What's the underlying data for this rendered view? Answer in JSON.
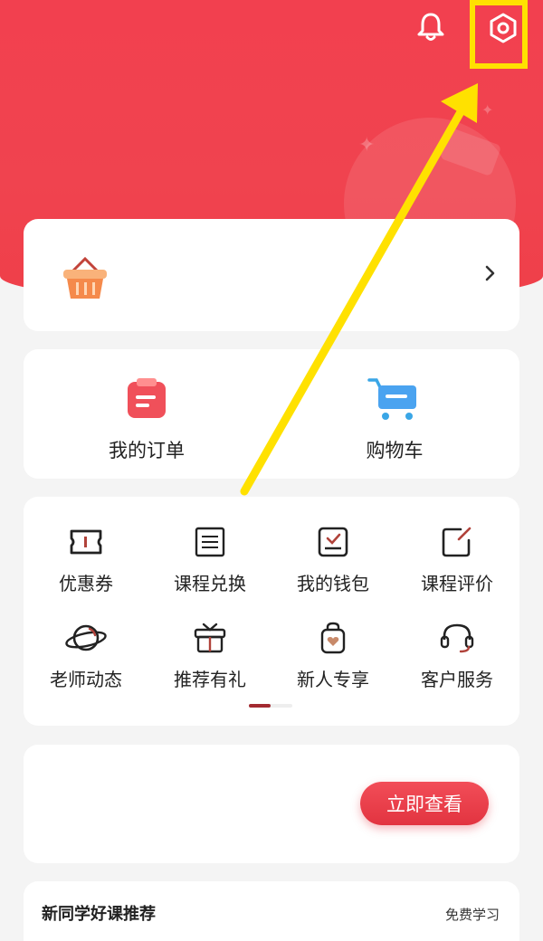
{
  "header": {
    "bell_icon": "bell-icon",
    "settings_icon": "gear-icon",
    "highlight_color": "#ffe100",
    "theme_color": "#ef3f4b"
  },
  "promo": {
    "icon": "basket-icon"
  },
  "orders": {
    "items": [
      {
        "label": "我的订单",
        "icon": "order-icon"
      },
      {
        "label": "购物车",
        "icon": "cart-icon"
      }
    ]
  },
  "services": {
    "items": [
      {
        "label": "优惠券",
        "icon": "ticket-icon"
      },
      {
        "label": "课程兑换",
        "icon": "list-icon"
      },
      {
        "label": "我的钱包",
        "icon": "wallet-icon"
      },
      {
        "label": "课程评价",
        "icon": "edit-icon"
      },
      {
        "label": "老师动态",
        "icon": "planet-icon"
      },
      {
        "label": "推荐有礼",
        "icon": "gift-icon"
      },
      {
        "label": "新人专享",
        "icon": "bag-icon"
      },
      {
        "label": "客户服务",
        "icon": "headset-icon"
      }
    ]
  },
  "banner": {
    "button_label": "立即查看"
  },
  "recommend": {
    "title": "新同学好课推荐",
    "link_label": "免费学习"
  }
}
